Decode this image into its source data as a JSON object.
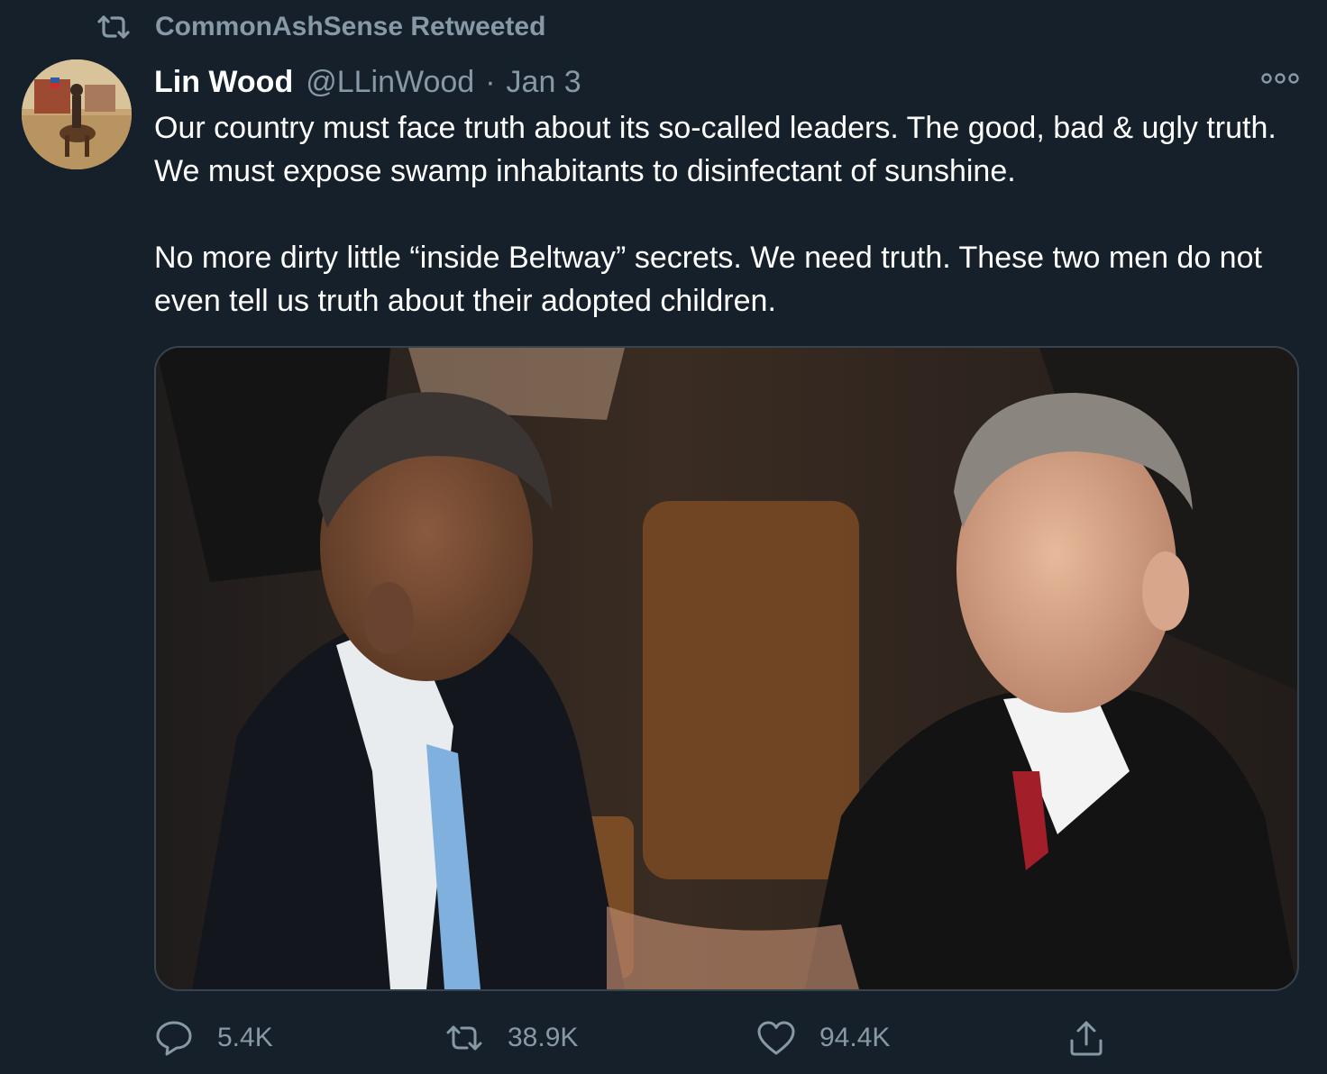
{
  "retweet_context": {
    "label": "CommonAshSense Retweeted"
  },
  "author": {
    "display_name": "Lin Wood",
    "handle": "@LLinWood",
    "separator": "·",
    "date": "Jan 3"
  },
  "tweet": {
    "paragraphs": [
      "Our country must face truth about its so-called leaders. The good, bad & ugly truth. We must expose swamp inhabitants to disinfectant of sunshine.",
      "No more dirty little “inside Beltway” secrets. We need truth. These two men do not even tell us truth about their adopted children."
    ]
  },
  "actions": {
    "reply_count": "5.4K",
    "retweet_count": "38.9K",
    "like_count": "94.4K"
  },
  "icons": {
    "retweet_context": "retweet-icon",
    "more": "more-options-icon",
    "reply": "reply-icon",
    "retweet": "retweet-icon",
    "like": "heart-icon",
    "share": "share-icon"
  },
  "colors": {
    "background": "#15202b",
    "secondary_text": "#8899a6",
    "primary_text": "#ffffff",
    "border": "#38444d"
  }
}
